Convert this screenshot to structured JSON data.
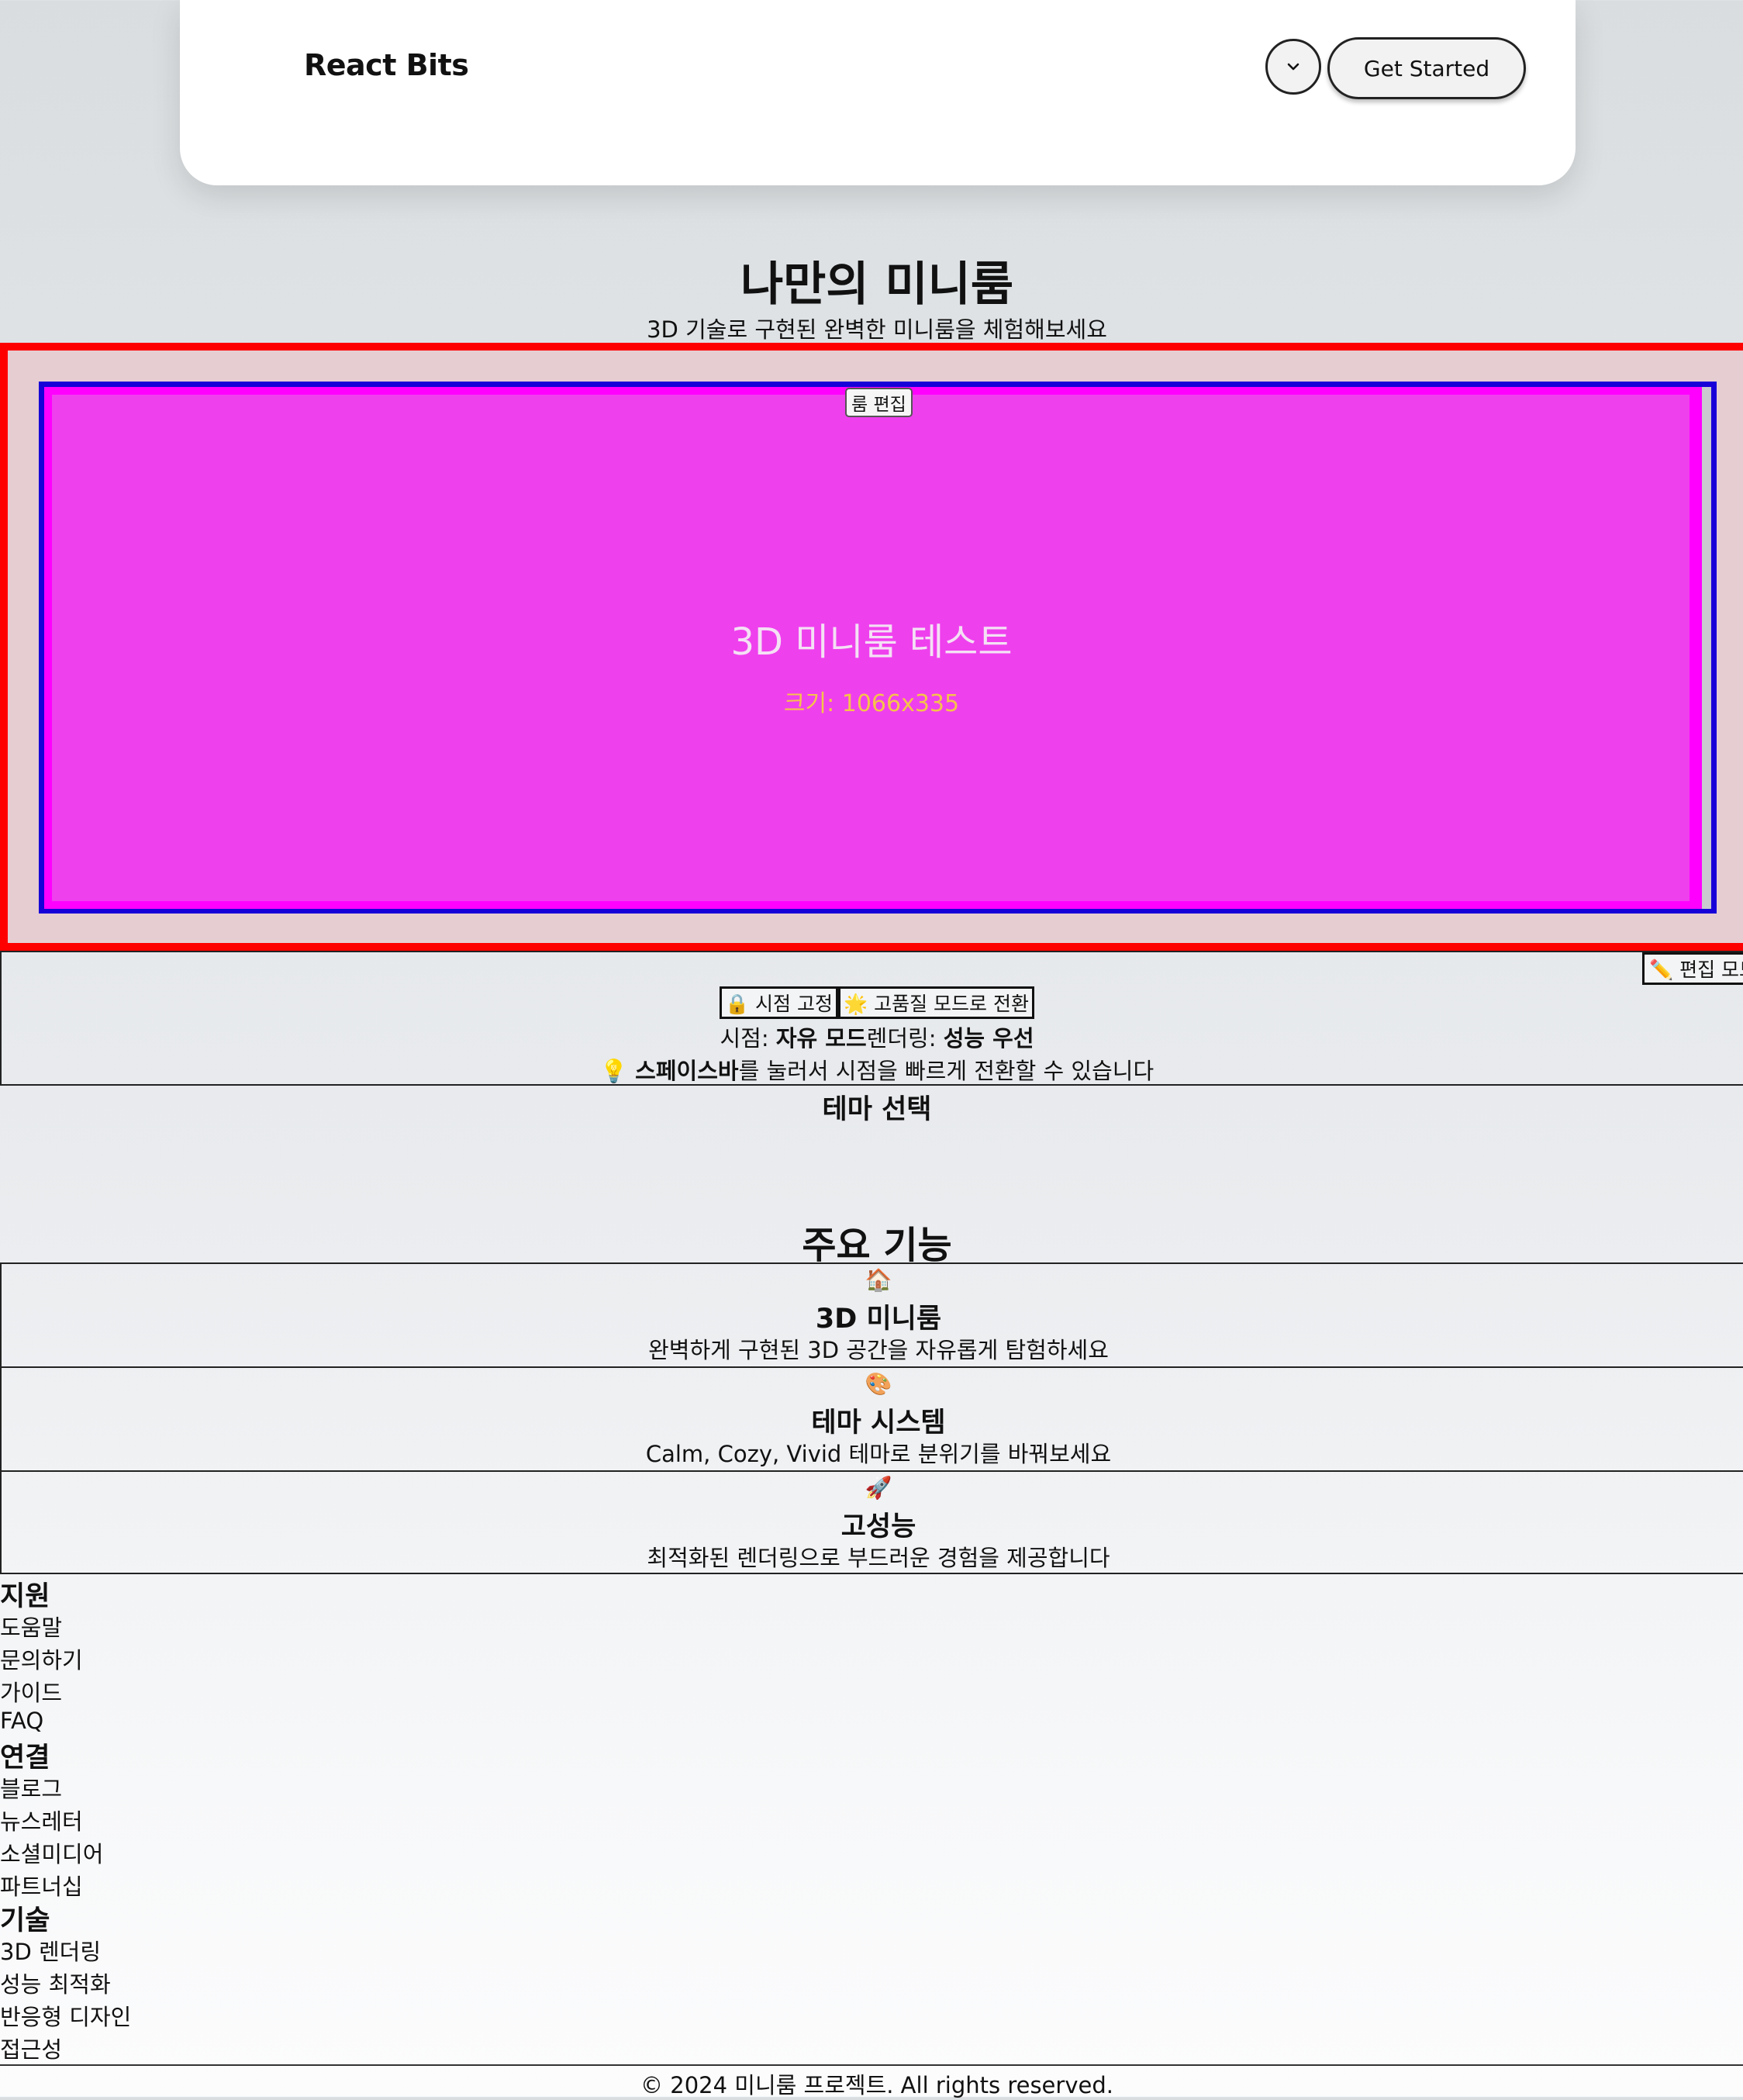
{
  "navbar": {
    "brand": "React Bits",
    "menu_icon": "chevron-down-icon",
    "cta_label": "Get Started"
  },
  "hero": {
    "title": "나만의 미니룸",
    "subtitle": "3D 기술로 구현된 완벽한 미니룸을 체험해보세요"
  },
  "room": {
    "edit_button": "룸 편집",
    "canvas_title": "3D 미니룸 테스트",
    "canvas_size": "크기: 1066x335"
  },
  "controls": {
    "edit_mode_label": "✏️ 편집 모드",
    "lock_view_label": "🔒 시점 고정",
    "quality_label": "🌟 고품질 모드로 전환",
    "status": {
      "view_prefix": "시점: ",
      "view_value": "자유 모드",
      "render_prefix": "렌더링: ",
      "render_value": "성능 우선"
    },
    "tip": {
      "icon": "💡",
      "key": "스페이스바",
      "text": "를 눌러서 시점을 빠르게 전환할 수 있습니다"
    }
  },
  "theme": {
    "heading": "테마 선택"
  },
  "features": {
    "heading": "주요 기능",
    "items": [
      {
        "icon": "🏠",
        "title": "3D 미니룸",
        "desc": "완벽하게 구현된 3D 공간을 자유롭게 탐험하세요"
      },
      {
        "icon": "🎨",
        "title": "테마 시스템",
        "desc": "Calm, Cozy, Vivid 테마로 분위기를 바꿔보세요"
      },
      {
        "icon": "🚀",
        "title": "고성능",
        "desc": "최적화된 렌더링으로 부드러운 경험을 제공합니다"
      }
    ]
  },
  "footer": {
    "columns": [
      {
        "heading": "지원",
        "links": [
          "도움말",
          "문의하기",
          "가이드",
          "FAQ"
        ]
      },
      {
        "heading": "연결",
        "links": [
          "블로그",
          "뉴스레터",
          "소셜미디어",
          "파트너십"
        ]
      },
      {
        "heading": "기술",
        "links": [
          "3D 렌더링",
          "성능 최적화",
          "반응형 디자인",
          "접근성"
        ]
      }
    ],
    "copyright": "© 2024 미니룸 프로젝트. All rights reserved."
  },
  "colors": {
    "stage_border": "#ff0000",
    "canvas_border": "#1800d8",
    "canvas_fill": "#ef40ee",
    "canvas_size_text": "#f5c34a"
  }
}
